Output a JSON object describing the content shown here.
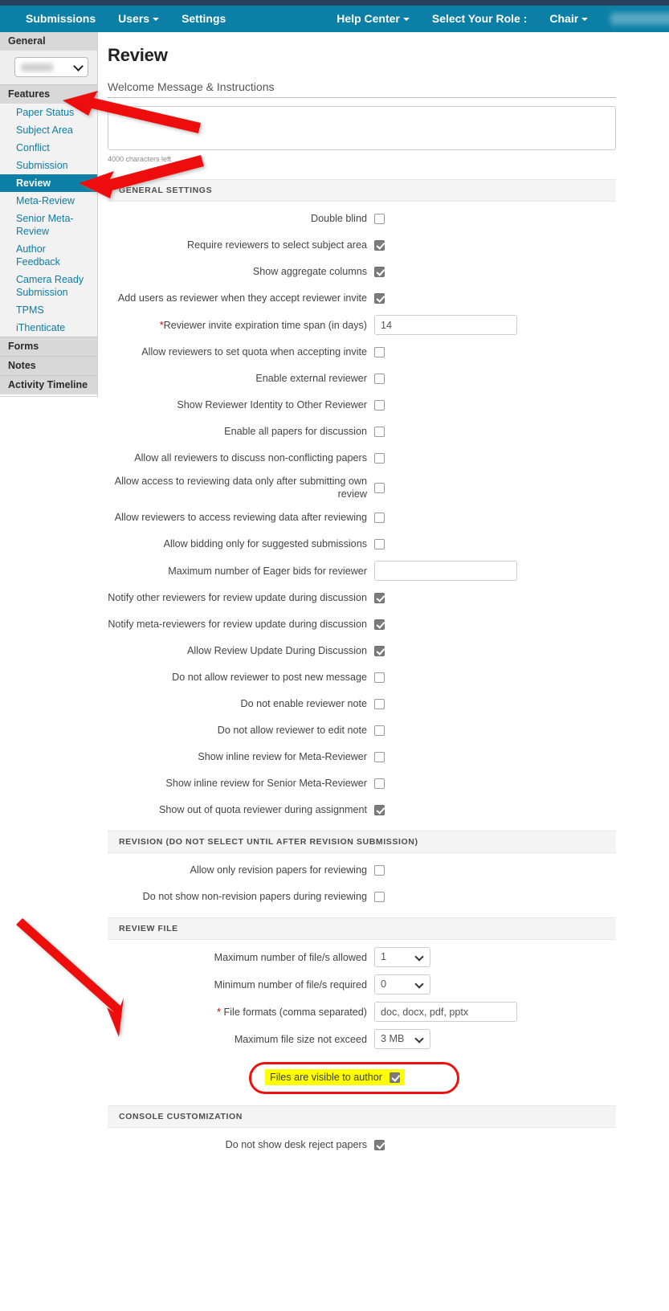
{
  "navbar": {
    "items": [
      {
        "label": "Submissions",
        "caret": false
      },
      {
        "label": "Users",
        "caret": true
      },
      {
        "label": "Settings",
        "caret": false
      }
    ],
    "right_items": [
      {
        "label": "Help Center",
        "caret": true
      },
      {
        "label": "Select Your Role :",
        "caret": false
      },
      {
        "label": "Chair",
        "caret": true
      }
    ],
    "redacted_user": "",
    "redacted_conf": ""
  },
  "sidebar": {
    "general_label": "General",
    "conference_select_value": "",
    "features_label": "Features",
    "features": [
      {
        "label": "Paper Status",
        "active": false
      },
      {
        "label": "Subject Area",
        "active": false
      },
      {
        "label": "Conflict",
        "active": false
      },
      {
        "label": "Submission",
        "active": false
      },
      {
        "label": "Review",
        "active": true
      },
      {
        "label": "Meta-Review",
        "active": false
      },
      {
        "label": "Senior Meta-Review",
        "active": false
      },
      {
        "label": "Author Feedback",
        "active": false
      },
      {
        "label": "Camera Ready Submission",
        "active": false
      },
      {
        "label": "TPMS",
        "active": false
      },
      {
        "label": "iThenticate",
        "active": false
      }
    ],
    "forms_label": "Forms",
    "notes_label": "Notes",
    "activity_timeline_label": "Activity Timeline"
  },
  "main": {
    "page_title": "Review",
    "welcome_label": "Welcome Message & Instructions",
    "welcome_value": "",
    "welcome_placeholder": "",
    "char_counter": "4000 characters left",
    "sections": [
      {
        "id": "general-settings",
        "title": "GENERAL SETTINGS",
        "rows": [
          {
            "label": "Double blind",
            "type": "checkbox",
            "checked": false
          },
          {
            "label": "Require reviewers to select subject area",
            "type": "checkbox",
            "checked": true
          },
          {
            "label": "Show aggregate columns",
            "type": "checkbox",
            "checked": true
          },
          {
            "label": "Add users as reviewer when they accept reviewer invite",
            "type": "checkbox",
            "checked": true
          },
          {
            "label": "Reviewer invite expiration time span (in days)",
            "required": true,
            "req_position": "before",
            "type": "text",
            "value": "14"
          },
          {
            "label": "Allow reviewers to set quota when accepting invite",
            "type": "checkbox",
            "checked": false
          },
          {
            "label": "Enable external reviewer",
            "type": "checkbox",
            "checked": false
          },
          {
            "label": "Show Reviewer Identity to Other Reviewer",
            "type": "checkbox",
            "checked": false
          },
          {
            "label": "Enable all papers for discussion",
            "type": "checkbox",
            "checked": false
          },
          {
            "label": "Allow all reviewers to discuss non-conflicting papers",
            "type": "checkbox",
            "checked": false
          },
          {
            "label": "Allow access to reviewing data only after submitting own review",
            "type": "checkbox",
            "checked": false
          },
          {
            "label": "Allow reviewers to access reviewing data after reviewing",
            "type": "checkbox",
            "checked": false
          },
          {
            "label": "Allow bidding only for suggested submissions",
            "type": "checkbox",
            "checked": false
          },
          {
            "label": "Maximum number of Eager bids for reviewer",
            "type": "text",
            "value": ""
          },
          {
            "label": "Notify other reviewers for review update during discussion",
            "type": "checkbox",
            "checked": true
          },
          {
            "label": "Notify meta-reviewers for review update during discussion",
            "type": "checkbox",
            "checked": true
          },
          {
            "label": "Allow Review Update During Discussion",
            "type": "checkbox",
            "checked": true
          },
          {
            "label": "Do not allow reviewer to post new message",
            "type": "checkbox",
            "checked": false
          },
          {
            "label": "Do not enable reviewer note",
            "type": "checkbox",
            "checked": false
          },
          {
            "label": "Do not allow reviewer to edit note",
            "type": "checkbox",
            "checked": false
          },
          {
            "label": "Show inline review for Meta-Reviewer",
            "type": "checkbox",
            "checked": false
          },
          {
            "label": "Show inline review for Senior Meta-Reviewer",
            "type": "checkbox",
            "checked": false
          },
          {
            "label": "Show out of quota reviewer during assignment",
            "type": "checkbox",
            "checked": true
          }
        ]
      },
      {
        "id": "revision",
        "title": "REVISION  (DO NOT SELECT UNTIL AFTER REVISION SUBMISSION)",
        "rows": [
          {
            "label": "Allow only revision papers for reviewing",
            "type": "checkbox",
            "checked": false
          },
          {
            "label": "Do not show non-revision papers during reviewing",
            "type": "checkbox",
            "checked": false
          }
        ]
      },
      {
        "id": "review-file",
        "title": "REVIEW FILE",
        "rows": [
          {
            "label": "Maximum number of file/s allowed",
            "type": "select",
            "value": "1"
          },
          {
            "label": "Minimum number of file/s required",
            "type": "select",
            "value": "0"
          },
          {
            "label": "File formats (comma separated)",
            "required": true,
            "req_position": "before-space",
            "type": "text",
            "value": "doc, docx, pdf, pptx",
            "wide": true
          },
          {
            "label": "Maximum file size not exceed",
            "type": "select",
            "value": "3 MB"
          }
        ]
      }
    ],
    "highlighted_row": {
      "label": "Files are visible to author",
      "checked": true,
      "highlight_color": "#ffff00",
      "outline_color": "#ee1111"
    },
    "console_section": {
      "id": "console-customization",
      "title": "CONSOLE CUSTOMIZATION",
      "rows": [
        {
          "label": "Do not show desk reject papers",
          "type": "checkbox",
          "checked": true
        }
      ]
    }
  },
  "annotations": {
    "arrow_color": "#ee1111",
    "arrows": [
      {
        "name": "arrow-to-features",
        "target": "Features"
      },
      {
        "name": "arrow-to-review",
        "target": "Review"
      },
      {
        "name": "arrow-to-review-file",
        "target": "REVIEW FILE"
      }
    ]
  },
  "colors": {
    "navbar": "#0b7fa5",
    "topstrip": "#27405b",
    "sidebar_active": "#0b7fa5",
    "link": "#0d7ca3",
    "required": "#cc0000"
  }
}
